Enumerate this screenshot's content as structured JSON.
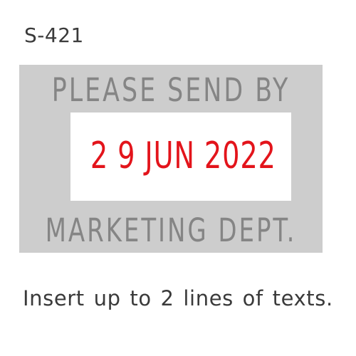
{
  "product": {
    "model_code": "S-421"
  },
  "stamp": {
    "top_line": "PLEASE SEND BY",
    "date": "2 9 JUN 2022",
    "bottom_line": "MARKETING DEPT.",
    "colors": {
      "impression_bg": "#cdcdcd",
      "text_gray": "#858585",
      "date_red": "#e3141b",
      "date_window_bg": "#ffffff"
    }
  },
  "caption": "Insert up to 2 lines of texts."
}
